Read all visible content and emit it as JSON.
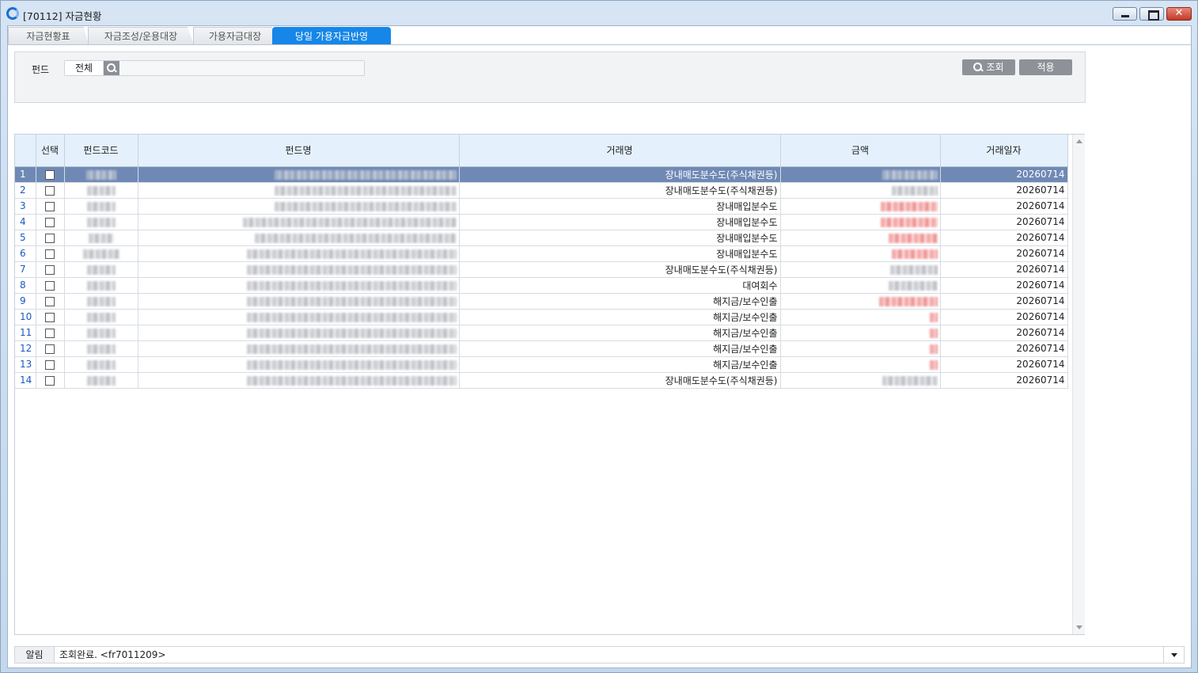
{
  "window": {
    "title": "[70112] 자금현황",
    "close_glyph": "✕"
  },
  "tabs": [
    {
      "label": "자금현황표"
    },
    {
      "label": "자금조성/운용대장"
    },
    {
      "label": "가용자금대장"
    },
    {
      "label": "당일 가용자금반영"
    }
  ],
  "search": {
    "fund_label": "펀드",
    "fund_value": "전체",
    "query_button": "조회",
    "apply_button": "적용"
  },
  "grid": {
    "columns": [
      "",
      "선택",
      "펀드코드",
      "펀드명",
      "거래명",
      "금액",
      "거래일자"
    ],
    "rows": [
      {
        "no": "1",
        "trade": "장내매도분수도(주식채권등)",
        "date": "20260714"
      },
      {
        "no": "2",
        "trade": "장내매도분수도(주식채권등)",
        "date": "20260714"
      },
      {
        "no": "3",
        "trade": "장내매입분수도",
        "date": "20260714"
      },
      {
        "no": "4",
        "trade": "장내매입분수도",
        "date": "20260714"
      },
      {
        "no": "5",
        "trade": "장내매입분수도",
        "date": "20260714"
      },
      {
        "no": "6",
        "trade": "장내매입분수도",
        "date": "20260714"
      },
      {
        "no": "7",
        "trade": "장내매도분수도(주식채권등)",
        "date": "20260714"
      },
      {
        "no": "8",
        "trade": "대여회수",
        "date": "20260714"
      },
      {
        "no": "9",
        "trade": "해지금/보수인출",
        "date": "20260714"
      },
      {
        "no": "10",
        "trade": "해지금/보수인출",
        "date": "20260714"
      },
      {
        "no": "11",
        "trade": "해지금/보수인출",
        "date": "20260714"
      },
      {
        "no": "12",
        "trade": "해지금/보수인출",
        "date": "20260714"
      },
      {
        "no": "13",
        "trade": "해지금/보수인출",
        "date": "20260714"
      },
      {
        "no": "14",
        "trade": "장내매도분수도(주식채권등)",
        "date": "20260714"
      }
    ],
    "selected_row": "1"
  },
  "status": {
    "label": "알림",
    "message": "조회완료. <fr7011209>"
  },
  "colors": {
    "active_tab": "#1687e8",
    "header_bg": "#e4f1fd",
    "selected_row": "#6f89b5",
    "row_number": "#1a58c4",
    "negative_amount": "#ef8c8c"
  }
}
